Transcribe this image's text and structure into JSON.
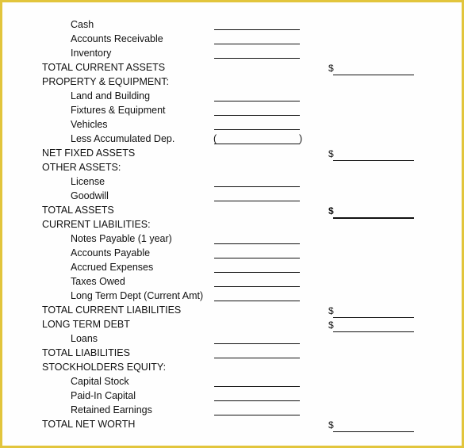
{
  "colors": {
    "border": "#e2c53c",
    "page": "#fefefe",
    "text": "#111111"
  },
  "currency_symbol": "$",
  "rows": [
    {
      "label": "Cash",
      "type": "sub"
    },
    {
      "label": "Accounts Receivable",
      "type": "sub"
    },
    {
      "label": "Inventory",
      "type": "sub"
    },
    {
      "label": "TOTAL CURRENT ASSETS",
      "type": "total"
    },
    {
      "label": "PROPERTY & EQUIPMENT:",
      "type": "header"
    },
    {
      "label": "Land and Building",
      "type": "sub"
    },
    {
      "label": "Fixtures & Equipment",
      "type": "sub"
    },
    {
      "label": "Vehicles",
      "type": "sub"
    },
    {
      "label": "Less Accumulated Dep.",
      "type": "paren",
      "open": "(",
      "close": ")"
    },
    {
      "label": "NET FIXED ASSETS",
      "type": "total"
    },
    {
      "label": "OTHER ASSETS:",
      "type": "header"
    },
    {
      "label": "License",
      "type": "sub"
    },
    {
      "label": "Goodwill",
      "type": "sub"
    },
    {
      "label": "TOTAL ASSETS",
      "type": "total",
      "bold": true
    },
    {
      "label": "CURRENT LIABILITIES:",
      "type": "header"
    },
    {
      "label": "Notes Payable (1 year)",
      "type": "sub"
    },
    {
      "label": "Accounts Payable",
      "type": "sub"
    },
    {
      "label": "Accrued Expenses",
      "type": "sub"
    },
    {
      "label": "Taxes Owed",
      "type": "sub"
    },
    {
      "label": "Long Term Dept (Current Amt)",
      "type": "sub"
    },
    {
      "label": "TOTAL CURRENT LIABILITIES",
      "type": "total"
    },
    {
      "label": "LONG TERM DEBT",
      "type": "total"
    },
    {
      "label": "Loans",
      "type": "sub"
    },
    {
      "label": "TOTAL LIABILITIES",
      "type": "header-line"
    },
    {
      "label": "STOCKHOLDERS EQUITY:",
      "type": "header"
    },
    {
      "label": "Capital Stock",
      "type": "sub"
    },
    {
      "label": "Paid-In Capital",
      "type": "sub"
    },
    {
      "label": "Retained Earnings",
      "type": "sub"
    },
    {
      "label": "TOTAL NET WORTH",
      "type": "total"
    }
  ]
}
